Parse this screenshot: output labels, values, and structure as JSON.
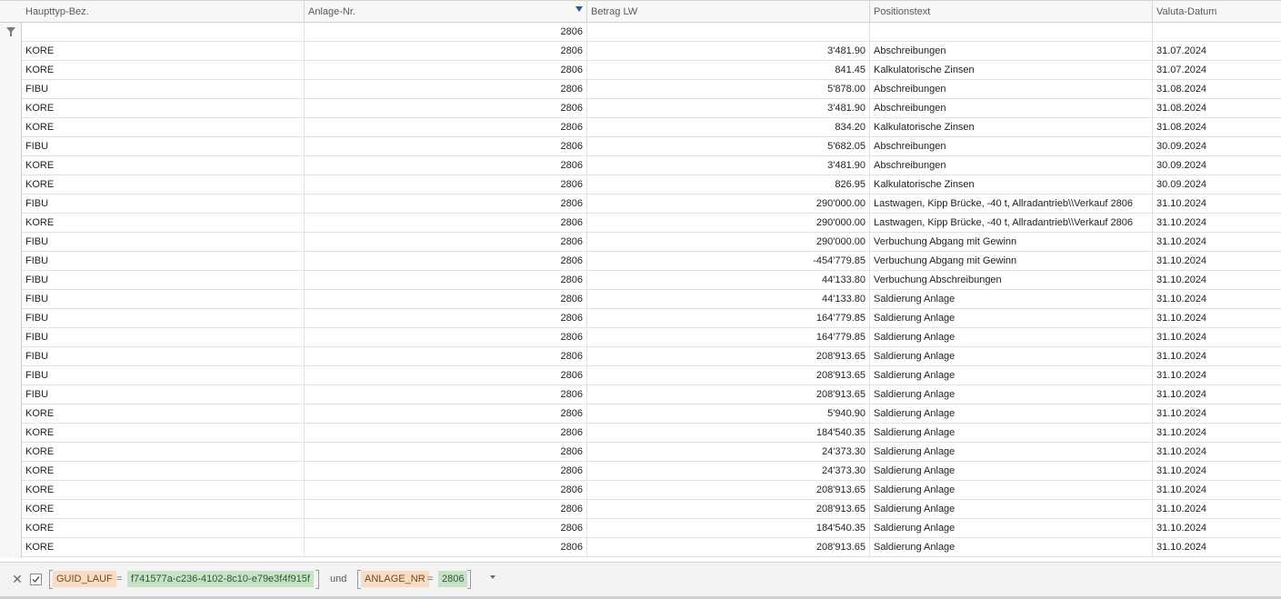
{
  "columns": [
    "Haupttyp-Bez.",
    "Anlage-Nr.",
    "Betrag LW",
    "Positionstext",
    "Valuta-Datum"
  ],
  "filter_row": {
    "anlage_nr": "2806"
  },
  "rows": [
    [
      "KORE",
      "2806",
      "3'481.90",
      "Abschreibungen",
      "31.07.2024"
    ],
    [
      "KORE",
      "2806",
      "841.45",
      "Kalkulatorische Zinsen",
      "31.07.2024"
    ],
    [
      "FIBU",
      "2806",
      "5'878.00",
      "Abschreibungen",
      "31.08.2024"
    ],
    [
      "KORE",
      "2806",
      "3'481.90",
      "Abschreibungen",
      "31.08.2024"
    ],
    [
      "KORE",
      "2806",
      "834.20",
      "Kalkulatorische Zinsen",
      "31.08.2024"
    ],
    [
      "FIBU",
      "2806",
      "5'682.05",
      "Abschreibungen",
      "30.09.2024"
    ],
    [
      "KORE",
      "2806",
      "3'481.90",
      "Abschreibungen",
      "30.09.2024"
    ],
    [
      "KORE",
      "2806",
      "826.95",
      "Kalkulatorische Zinsen",
      "30.09.2024"
    ],
    [
      "FIBU",
      "2806",
      "290'000.00",
      "Lastwagen, Kipp Brücke, -40 t, Allradantrieb\\\\Verkauf 2806",
      "31.10.2024"
    ],
    [
      "KORE",
      "2806",
      "290'000.00",
      "Lastwagen, Kipp Brücke, -40 t, Allradantrieb\\\\Verkauf 2806",
      "31.10.2024"
    ],
    [
      "FIBU",
      "2806",
      "290'000.00",
      "Verbuchung Abgang mit Gewinn",
      "31.10.2024"
    ],
    [
      "FIBU",
      "2806",
      "-454'779.85",
      "Verbuchung Abgang mit Gewinn",
      "31.10.2024"
    ],
    [
      "FIBU",
      "2806",
      "44'133.80",
      "Verbuchung Abschreibungen",
      "31.10.2024"
    ],
    [
      "FIBU",
      "2806",
      "44'133.80",
      "Saldierung Anlage",
      "31.10.2024"
    ],
    [
      "FIBU",
      "2806",
      "164'779.85",
      "Saldierung Anlage",
      "31.10.2024"
    ],
    [
      "FIBU",
      "2806",
      "164'779.85",
      "Saldierung Anlage",
      "31.10.2024"
    ],
    [
      "FIBU",
      "2806",
      "208'913.65",
      "Saldierung Anlage",
      "31.10.2024"
    ],
    [
      "FIBU",
      "2806",
      "208'913.65",
      "Saldierung Anlage",
      "31.10.2024"
    ],
    [
      "FIBU",
      "2806",
      "208'913.65",
      "Saldierung Anlage",
      "31.10.2024"
    ],
    [
      "KORE",
      "2806",
      "5'940.90",
      "Saldierung Anlage",
      "31.10.2024"
    ],
    [
      "KORE",
      "2806",
      "184'540.35",
      "Saldierung Anlage",
      "31.10.2024"
    ],
    [
      "KORE",
      "2806",
      "24'373.30",
      "Saldierung Anlage",
      "31.10.2024"
    ],
    [
      "KORE",
      "2806",
      "24'373.30",
      "Saldierung Anlage",
      "31.10.2024"
    ],
    [
      "KORE",
      "2806",
      "208'913.65",
      "Saldierung Anlage",
      "31.10.2024"
    ],
    [
      "KORE",
      "2806",
      "208'913.65",
      "Saldierung Anlage",
      "31.10.2024"
    ],
    [
      "KORE",
      "2806",
      "184'540.35",
      "Saldierung Anlage",
      "31.10.2024"
    ],
    [
      "KORE",
      "2806",
      "208'913.65",
      "Saldierung Anlage",
      "31.10.2024"
    ]
  ],
  "filter_panel": {
    "close_icon": "close-icon",
    "enabled": true,
    "condition1": {
      "field": "GUID_LAUF",
      "op": "=",
      "value": "f741577a-c236-4102-8c10-e79e3f4f915f"
    },
    "joiner": "und",
    "condition2": {
      "field": "ANLAGE_NR",
      "op": "=",
      "value": "2806"
    }
  },
  "colors": {
    "field_bg": "#f9dcc3",
    "value_bg": "#c8e2c8",
    "header_bg": "#f7f7f7",
    "sort_indicator": "#2b579a"
  }
}
